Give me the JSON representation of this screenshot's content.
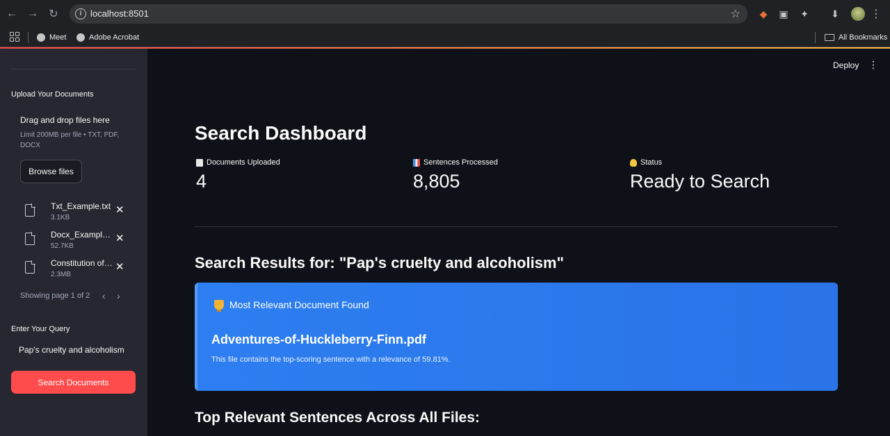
{
  "browser": {
    "url": "localhost:8501",
    "bookmarks": [
      "Meet",
      "Adobe Acrobat"
    ],
    "all_bookmarks": "All Bookmarks"
  },
  "sidebar": {
    "upload_label": "Upload Your Documents",
    "dropzone_title": "Drag and drop files here",
    "dropzone_hint": "Limit 200MB per file • TXT, PDF, DOCX",
    "browse_button": "Browse files",
    "files": [
      {
        "name": "Txt_Example.txt",
        "size": "3.1KB"
      },
      {
        "name": "Docx_Example.docx",
        "size": "52.7KB"
      },
      {
        "name": "Constitution of India.pdf",
        "size": "2.3MB"
      }
    ],
    "pager_text": "Showing page 1 of 2",
    "query_label": "Enter Your Query",
    "query_value": "Pap's cruelty and alcoholism",
    "search_button": "Search Documents"
  },
  "header": {
    "deploy": "Deploy"
  },
  "main": {
    "title": "Search Dashboard",
    "metrics": [
      {
        "label": "Documents Uploaded",
        "value": "4",
        "icon": "document-icon"
      },
      {
        "label": "Sentences Processed",
        "value": "8,805",
        "icon": "bar-chart-icon"
      },
      {
        "label": "Status",
        "value": "Ready to Search",
        "icon": "lightbulb-icon"
      }
    ],
    "results_heading": "Search Results for: \"Pap's cruelty and alcoholism\"",
    "card": {
      "heading": "Most Relevant Document Found",
      "document": "Adventures-of-Huckleberry-Finn.pdf",
      "description": "This file contains the top-scoring sentence with a relevance of 59.81%."
    },
    "bottom_heading": "Top Relevant Sentences Across All Files:"
  },
  "colors": {
    "primary": "#ff4b4b",
    "card": "#2d7ef0",
    "background": "#0e1117",
    "sidebar": "#262730"
  }
}
